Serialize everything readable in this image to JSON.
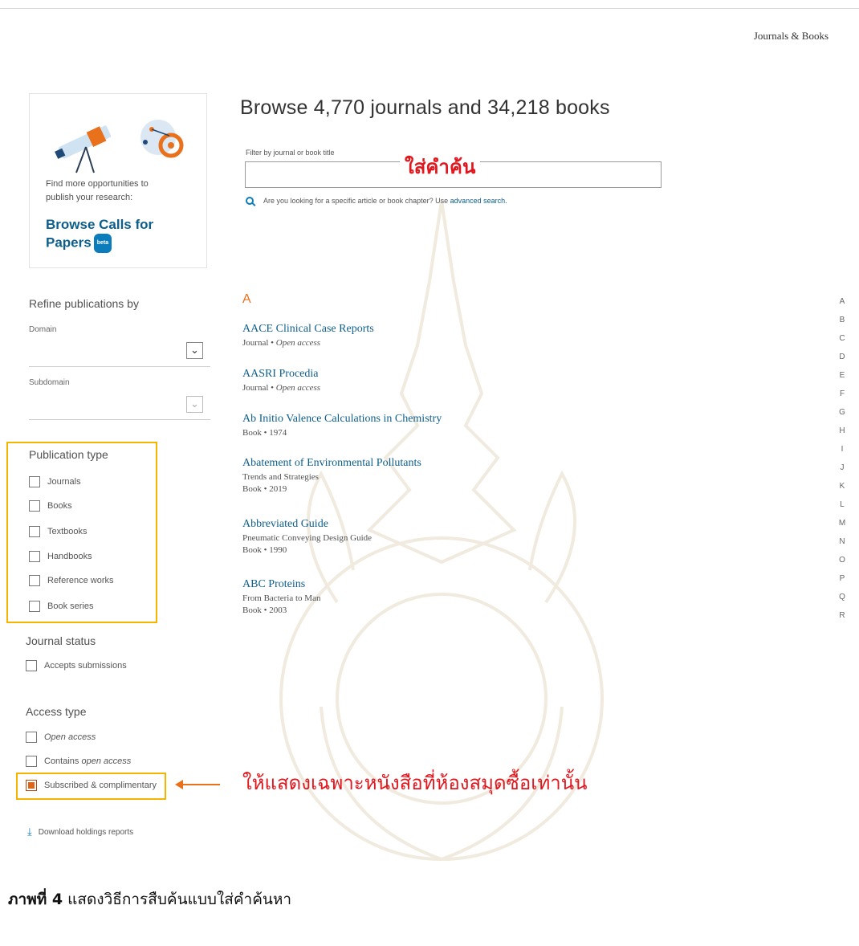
{
  "top_nav": {
    "link": "Journals & Books"
  },
  "promo": {
    "text_line1": "Find more opportunities to",
    "text_line2": "publish your research:",
    "link_line1": "Browse Calls for",
    "link_line2": "Papers",
    "badge": "beta"
  },
  "filters": {
    "refine_title": "Refine publications by",
    "domain_label": "Domain",
    "subdomain_label": "Subdomain",
    "publication_type_title": "Publication type",
    "publication_types": [
      "Journals",
      "Books",
      "Textbooks",
      "Handbooks",
      "Reference works",
      "Book series"
    ],
    "journal_status_title": "Journal status",
    "journal_status_option": "Accepts submissions",
    "access_type_title": "Access type",
    "access_open": "Open access",
    "access_contains_prefix": "Contains",
    "access_contains_italic": "open access",
    "access_subscribed": "Subscribed & complimentary",
    "download": "Download holdings reports"
  },
  "main": {
    "heading": "Browse 4,770 journals and 34,218 books",
    "filter_label": "Filter by journal or book title",
    "search_hint_prefix": "Are you looking for a specific article or book chapter? Use",
    "search_hint_link": "advanced search.",
    "letter": "A",
    "publications": [
      {
        "title": "AACE Clinical Case Reports",
        "subtitle": "",
        "type": "Journal",
        "info": "Open access"
      },
      {
        "title": "AASRI Procedia",
        "subtitle": "",
        "type": "Journal",
        "info": "Open access"
      },
      {
        "title": "Ab Initio Valence Calculations in Chemistry",
        "subtitle": "",
        "type": "Book",
        "info": "1974"
      },
      {
        "title": "Abatement of Environmental Pollutants",
        "subtitle": "Trends and Strategies",
        "type": "Book",
        "info": "2019"
      },
      {
        "title": "Abbreviated Guide",
        "subtitle": "Pneumatic Conveying Design Guide",
        "type": "Book",
        "info": "1990"
      },
      {
        "title": "ABC Proteins",
        "subtitle": "From Bacteria to Man",
        "type": "Book",
        "info": "2003"
      }
    ],
    "meta_separator": "•"
  },
  "alphabet": [
    "A",
    "B",
    "C",
    "D",
    "E",
    "F",
    "G",
    "H",
    "I",
    "J",
    "K",
    "L",
    "M",
    "N",
    "O",
    "P",
    "Q",
    "R"
  ],
  "annotations": {
    "search_hint": "ใส่คำค้น",
    "subscribed_note": "ให้แสดงเฉพาะหนังสือที่ห้องสมุดซื้อเท่านั้น",
    "caption_bold": "ภาพที่ 4",
    "caption_text": "แสดงวิธีการสืบค้นแบบใส่คำค้นหา"
  },
  "colors": {
    "link": "#0c5e8c",
    "accent": "#e9711c",
    "highlight": "#f5b400",
    "annotation": "#e1171e"
  }
}
